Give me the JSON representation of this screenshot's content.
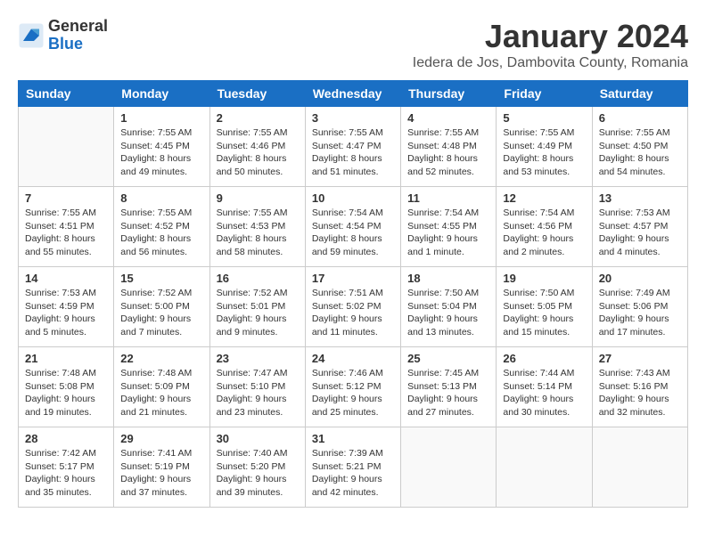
{
  "header": {
    "logo_general": "General",
    "logo_blue": "Blue",
    "title": "January 2024",
    "subtitle": "Iedera de Jos, Dambovita County, Romania"
  },
  "weekdays": [
    "Sunday",
    "Monday",
    "Tuesday",
    "Wednesday",
    "Thursday",
    "Friday",
    "Saturday"
  ],
  "weeks": [
    [
      {
        "day": "",
        "info": ""
      },
      {
        "day": "1",
        "info": "Sunrise: 7:55 AM\nSunset: 4:45 PM\nDaylight: 8 hours\nand 49 minutes."
      },
      {
        "day": "2",
        "info": "Sunrise: 7:55 AM\nSunset: 4:46 PM\nDaylight: 8 hours\nand 50 minutes."
      },
      {
        "day": "3",
        "info": "Sunrise: 7:55 AM\nSunset: 4:47 PM\nDaylight: 8 hours\nand 51 minutes."
      },
      {
        "day": "4",
        "info": "Sunrise: 7:55 AM\nSunset: 4:48 PM\nDaylight: 8 hours\nand 52 minutes."
      },
      {
        "day": "5",
        "info": "Sunrise: 7:55 AM\nSunset: 4:49 PM\nDaylight: 8 hours\nand 53 minutes."
      },
      {
        "day": "6",
        "info": "Sunrise: 7:55 AM\nSunset: 4:50 PM\nDaylight: 8 hours\nand 54 minutes."
      }
    ],
    [
      {
        "day": "7",
        "info": "Sunrise: 7:55 AM\nSunset: 4:51 PM\nDaylight: 8 hours\nand 55 minutes."
      },
      {
        "day": "8",
        "info": "Sunrise: 7:55 AM\nSunset: 4:52 PM\nDaylight: 8 hours\nand 56 minutes."
      },
      {
        "day": "9",
        "info": "Sunrise: 7:55 AM\nSunset: 4:53 PM\nDaylight: 8 hours\nand 58 minutes."
      },
      {
        "day": "10",
        "info": "Sunrise: 7:54 AM\nSunset: 4:54 PM\nDaylight: 8 hours\nand 59 minutes."
      },
      {
        "day": "11",
        "info": "Sunrise: 7:54 AM\nSunset: 4:55 PM\nDaylight: 9 hours\nand 1 minute."
      },
      {
        "day": "12",
        "info": "Sunrise: 7:54 AM\nSunset: 4:56 PM\nDaylight: 9 hours\nand 2 minutes."
      },
      {
        "day": "13",
        "info": "Sunrise: 7:53 AM\nSunset: 4:57 PM\nDaylight: 9 hours\nand 4 minutes."
      }
    ],
    [
      {
        "day": "14",
        "info": "Sunrise: 7:53 AM\nSunset: 4:59 PM\nDaylight: 9 hours\nand 5 minutes."
      },
      {
        "day": "15",
        "info": "Sunrise: 7:52 AM\nSunset: 5:00 PM\nDaylight: 9 hours\nand 7 minutes."
      },
      {
        "day": "16",
        "info": "Sunrise: 7:52 AM\nSunset: 5:01 PM\nDaylight: 9 hours\nand 9 minutes."
      },
      {
        "day": "17",
        "info": "Sunrise: 7:51 AM\nSunset: 5:02 PM\nDaylight: 9 hours\nand 11 minutes."
      },
      {
        "day": "18",
        "info": "Sunrise: 7:50 AM\nSunset: 5:04 PM\nDaylight: 9 hours\nand 13 minutes."
      },
      {
        "day": "19",
        "info": "Sunrise: 7:50 AM\nSunset: 5:05 PM\nDaylight: 9 hours\nand 15 minutes."
      },
      {
        "day": "20",
        "info": "Sunrise: 7:49 AM\nSunset: 5:06 PM\nDaylight: 9 hours\nand 17 minutes."
      }
    ],
    [
      {
        "day": "21",
        "info": "Sunrise: 7:48 AM\nSunset: 5:08 PM\nDaylight: 9 hours\nand 19 minutes."
      },
      {
        "day": "22",
        "info": "Sunrise: 7:48 AM\nSunset: 5:09 PM\nDaylight: 9 hours\nand 21 minutes."
      },
      {
        "day": "23",
        "info": "Sunrise: 7:47 AM\nSunset: 5:10 PM\nDaylight: 9 hours\nand 23 minutes."
      },
      {
        "day": "24",
        "info": "Sunrise: 7:46 AM\nSunset: 5:12 PM\nDaylight: 9 hours\nand 25 minutes."
      },
      {
        "day": "25",
        "info": "Sunrise: 7:45 AM\nSunset: 5:13 PM\nDaylight: 9 hours\nand 27 minutes."
      },
      {
        "day": "26",
        "info": "Sunrise: 7:44 AM\nSunset: 5:14 PM\nDaylight: 9 hours\nand 30 minutes."
      },
      {
        "day": "27",
        "info": "Sunrise: 7:43 AM\nSunset: 5:16 PM\nDaylight: 9 hours\nand 32 minutes."
      }
    ],
    [
      {
        "day": "28",
        "info": "Sunrise: 7:42 AM\nSunset: 5:17 PM\nDaylight: 9 hours\nand 35 minutes."
      },
      {
        "day": "29",
        "info": "Sunrise: 7:41 AM\nSunset: 5:19 PM\nDaylight: 9 hours\nand 37 minutes."
      },
      {
        "day": "30",
        "info": "Sunrise: 7:40 AM\nSunset: 5:20 PM\nDaylight: 9 hours\nand 39 minutes."
      },
      {
        "day": "31",
        "info": "Sunrise: 7:39 AM\nSunset: 5:21 PM\nDaylight: 9 hours\nand 42 minutes."
      },
      {
        "day": "",
        "info": ""
      },
      {
        "day": "",
        "info": ""
      },
      {
        "day": "",
        "info": ""
      }
    ]
  ]
}
